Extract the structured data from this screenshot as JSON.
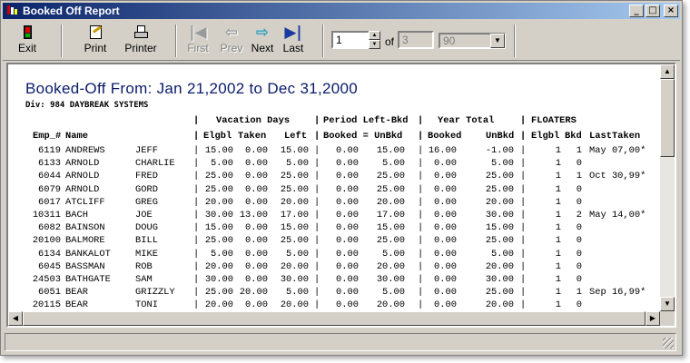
{
  "window": {
    "title": "Booked Off Report"
  },
  "title_buttons": {
    "minimize": "_",
    "maximize": "□",
    "close": "×"
  },
  "toolbar": {
    "exit": "Exit",
    "print": "Print",
    "printer": "Printer",
    "first": "First",
    "prev": "Prev",
    "next": "Next",
    "last": "Last",
    "page_value": "1",
    "of_label": "of",
    "page_count": "3",
    "zoom_value": "90"
  },
  "report": {
    "title": "Booked-Off  From: Jan 21,2002 to Dec 31,2000",
    "division": "Div: 984 DAYBREAK SYSTEMS",
    "group_headers": {
      "vacation": "Vacation Days",
      "period": "Period Left-Bkd",
      "year": "Year Total",
      "floaters": "FLOATERS"
    },
    "columns": [
      "Emp_#",
      "Name",
      "Elgbl",
      "Taken",
      "Left",
      "Booked = UnBkd",
      "Booked",
      "UnBkd",
      "Elgbl",
      "Bkd",
      "LastTaken"
    ],
    "rows": [
      {
        "emp": "6119",
        "last": "ANDREWS",
        "first": "JEFF",
        "elgbl": "15.00",
        "taken": "0.00",
        "left": "15.00",
        "pbooked": "0.00",
        "punbkd": "15.00",
        "ybooked": "16.00",
        "yunbkd": "-1.00",
        "felgbl": "1",
        "fbkd": "1",
        "lasttaken": "May 07,00*"
      },
      {
        "emp": "6133",
        "last": "ARNOLD",
        "first": "CHARLIE",
        "elgbl": "5.00",
        "taken": "0.00",
        "left": "5.00",
        "pbooked": "0.00",
        "punbkd": "5.00",
        "ybooked": "0.00",
        "yunbkd": "5.00",
        "felgbl": "1",
        "fbkd": "0",
        "lasttaken": ""
      },
      {
        "emp": "6044",
        "last": "ARNOLD",
        "first": "FRED",
        "elgbl": "25.00",
        "taken": "0.00",
        "left": "25.00",
        "pbooked": "0.00",
        "punbkd": "25.00",
        "ybooked": "0.00",
        "yunbkd": "25.00",
        "felgbl": "1",
        "fbkd": "1",
        "lasttaken": "Oct 30,99*"
      },
      {
        "emp": "6079",
        "last": "ARNOLD",
        "first": "GORD",
        "elgbl": "25.00",
        "taken": "0.00",
        "left": "25.00",
        "pbooked": "0.00",
        "punbkd": "25.00",
        "ybooked": "0.00",
        "yunbkd": "25.00",
        "felgbl": "1",
        "fbkd": "0",
        "lasttaken": ""
      },
      {
        "emp": "6017",
        "last": "ATCLIFF",
        "first": "GREG",
        "elgbl": "20.00",
        "taken": "0.00",
        "left": "20.00",
        "pbooked": "0.00",
        "punbkd": "20.00",
        "ybooked": "0.00",
        "yunbkd": "20.00",
        "felgbl": "1",
        "fbkd": "0",
        "lasttaken": ""
      },
      {
        "emp": "10311",
        "last": "BACH",
        "first": "JOE",
        "elgbl": "30.00",
        "taken": "13.00",
        "left": "17.00",
        "pbooked": "0.00",
        "punbkd": "17.00",
        "ybooked": "0.00",
        "yunbkd": "30.00",
        "felgbl": "1",
        "fbkd": "2",
        "lasttaken": "May 14,00*"
      },
      {
        "emp": "6082",
        "last": "BAINSON",
        "first": "DOUG",
        "elgbl": "15.00",
        "taken": "0.00",
        "left": "15.00",
        "pbooked": "0.00",
        "punbkd": "15.00",
        "ybooked": "0.00",
        "yunbkd": "15.00",
        "felgbl": "1",
        "fbkd": "0",
        "lasttaken": ""
      },
      {
        "emp": "20100",
        "last": "BALMORE",
        "first": "BILL",
        "elgbl": "25.00",
        "taken": "0.00",
        "left": "25.00",
        "pbooked": "0.00",
        "punbkd": "25.00",
        "ybooked": "0.00",
        "yunbkd": "25.00",
        "felgbl": "1",
        "fbkd": "0",
        "lasttaken": ""
      },
      {
        "emp": "6134",
        "last": "BANKALOT",
        "first": "MIKE",
        "elgbl": "5.00",
        "taken": "0.00",
        "left": "5.00",
        "pbooked": "0.00",
        "punbkd": "5.00",
        "ybooked": "0.00",
        "yunbkd": "5.00",
        "felgbl": "1",
        "fbkd": "0",
        "lasttaken": ""
      },
      {
        "emp": "6045",
        "last": "BASSMAN",
        "first": "ROB",
        "elgbl": "20.00",
        "taken": "0.00",
        "left": "20.00",
        "pbooked": "0.00",
        "punbkd": "20.00",
        "ybooked": "0.00",
        "yunbkd": "20.00",
        "felgbl": "1",
        "fbkd": "0",
        "lasttaken": ""
      },
      {
        "emp": "24503",
        "last": "BATHGATE",
        "first": "SAM",
        "elgbl": "30.00",
        "taken": "0.00",
        "left": "30.00",
        "pbooked": "0.00",
        "punbkd": "30.00",
        "ybooked": "0.00",
        "yunbkd": "30.00",
        "felgbl": "1",
        "fbkd": "0",
        "lasttaken": ""
      },
      {
        "emp": "6051",
        "last": "BEAR",
        "first": "GRIZZLY",
        "elgbl": "25.00",
        "taken": "20.00",
        "left": "5.00",
        "pbooked": "0.00",
        "punbkd": "5.00",
        "ybooked": "0.00",
        "yunbkd": "25.00",
        "felgbl": "1",
        "fbkd": "1",
        "lasttaken": "Sep 16,99*"
      },
      {
        "emp": "20115",
        "last": "BEAR",
        "first": "TONI",
        "elgbl": "20.00",
        "taken": "0.00",
        "left": "20.00",
        "pbooked": "0.00",
        "punbkd": "20.00",
        "ybooked": "0.00",
        "yunbkd": "20.00",
        "felgbl": "1",
        "fbkd": "0",
        "lasttaken": ""
      }
    ]
  },
  "scroll": {
    "up": "▲",
    "down": "▼",
    "left": "◀",
    "right": "▶"
  }
}
